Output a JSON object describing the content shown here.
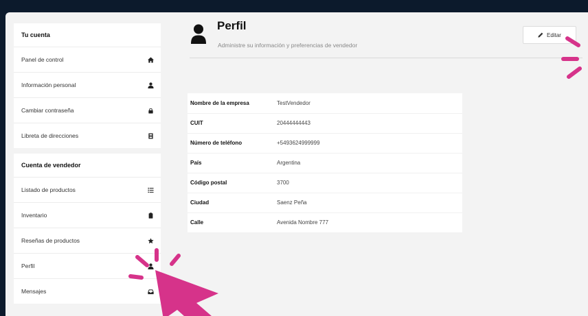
{
  "sidebar": {
    "account_title": "Tu cuenta",
    "account_items": [
      {
        "label": "Panel de control",
        "icon": "home-icon"
      },
      {
        "label": "Información personal",
        "icon": "user-icon"
      },
      {
        "label": "Cambiar contraseña",
        "icon": "lock-icon"
      },
      {
        "label": "Libreta de direcciones",
        "icon": "address-book-icon"
      }
    ],
    "seller_title": "Cuenta de vendedor",
    "seller_items": [
      {
        "label": "Listado de productos",
        "icon": "list-icon"
      },
      {
        "label": "Inventario",
        "icon": "clipboard-icon"
      },
      {
        "label": "Reseñas de productos",
        "icon": "star-icon"
      },
      {
        "label": "Perfil",
        "icon": "user-icon"
      },
      {
        "label": "Mensajes",
        "icon": "inbox-icon"
      }
    ]
  },
  "header": {
    "title": "Perfil",
    "subtitle": "Administre su información y preferencias de vendedor",
    "edit_label": "Editar"
  },
  "profile_fields": [
    {
      "key": "Nombre de la empresa",
      "value": "TestVendedor"
    },
    {
      "key": "CUIT",
      "value": "20444444443"
    },
    {
      "key": "Número de teléfono",
      "value": "+5493624999999"
    },
    {
      "key": "País",
      "value": "Argentina"
    },
    {
      "key": "Código postal",
      "value": "3700"
    },
    {
      "key": "Ciudad",
      "value": "Saenz Peña"
    },
    {
      "key": "Calle",
      "value": "Avenida Nombre 777"
    }
  ],
  "colors": {
    "background": "#0c1a2c",
    "accent_pointer": "#d6338a"
  }
}
